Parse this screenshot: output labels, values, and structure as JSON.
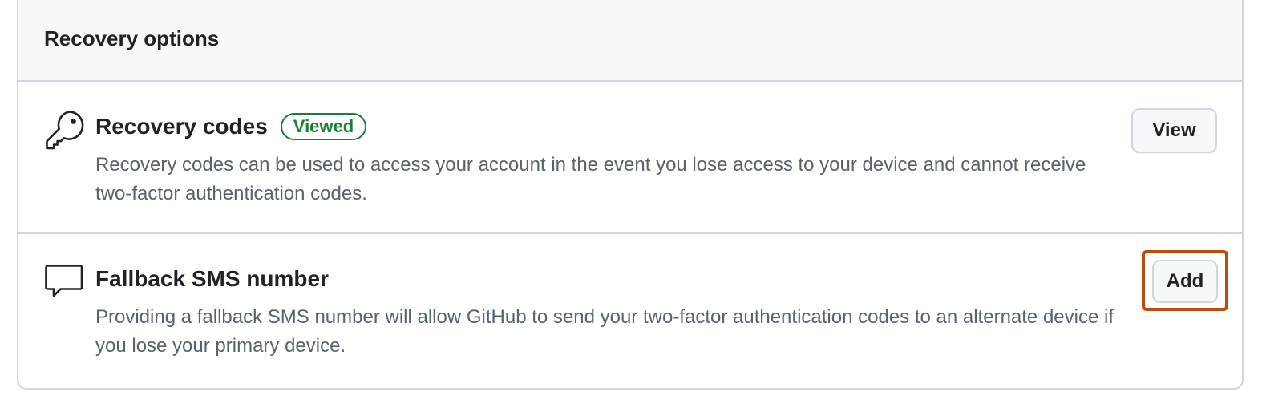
{
  "panel": {
    "title": "Recovery options"
  },
  "recovery_codes": {
    "icon": "key-icon",
    "title": "Recovery codes",
    "badge": "Viewed",
    "description": "Recovery codes can be used to access your account in the event you lose access to your device and cannot receive two-factor authentication codes.",
    "button_label": "View"
  },
  "fallback_sms": {
    "icon": "comment-icon",
    "title": "Fallback SMS number",
    "description": "Providing a fallback SMS number will allow GitHub to send your two-factor authentication codes to an alternate device if you lose your primary device.",
    "button_label": "Add"
  },
  "colors": {
    "badge_green": "#1a7f37",
    "highlight_orange": "#c04a0a",
    "border": "#d0d7de",
    "header_bg": "#f6f8fa"
  }
}
